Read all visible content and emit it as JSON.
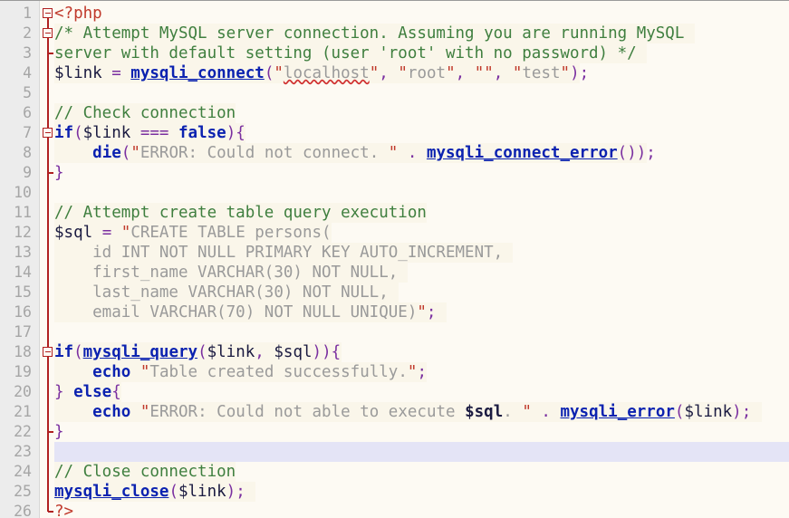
{
  "editor": {
    "language": "PHP",
    "total_lines": 26,
    "current_line": 23,
    "line_height": 22,
    "char_width": 10.55,
    "colors": {
      "background": "#fdfaf3",
      "gutter_background": "#ececec",
      "gutter_text": "#a6a6a6",
      "current_line_highlight": "#e4e4f6",
      "fold_marker": "#b02020",
      "tag": "#c0392b",
      "comment": "#3f7f3f",
      "keyword": "#0b22b0",
      "function": "#0b22b0",
      "variable": "#1a1a40",
      "punctuation": "#7a2fa0",
      "string": "#9a9a9a",
      "quote": "#c0392b",
      "spellcheck_underline": "#d03030"
    }
  },
  "line_numbers": [
    1,
    2,
    3,
    4,
    5,
    6,
    7,
    8,
    9,
    10,
    11,
    12,
    13,
    14,
    15,
    16,
    17,
    18,
    19,
    20,
    21,
    22,
    23,
    24,
    25,
    26
  ],
  "fold_boxes": [
    1,
    2,
    7,
    18
  ],
  "fold_ticks": [
    3,
    9,
    22,
    26
  ],
  "lines": [
    {
      "n": 1,
      "text": "<?php"
    },
    {
      "n": 2,
      "text": "/* Attempt MySQL server connection. Assuming you are running MySQL"
    },
    {
      "n": 3,
      "text": "server with default setting (user 'root' with no password) */"
    },
    {
      "n": 4,
      "text": "$link = mysqli_connect(\"localhost\", \"root\", \"\", \"test\");"
    },
    {
      "n": 5,
      "text": ""
    },
    {
      "n": 6,
      "text": "// Check connection"
    },
    {
      "n": 7,
      "text": "if($link === false){"
    },
    {
      "n": 8,
      "text": "    die(\"ERROR: Could not connect. \" . mysqli_connect_error());"
    },
    {
      "n": 9,
      "text": "}"
    },
    {
      "n": 10,
      "text": ""
    },
    {
      "n": 11,
      "text": "// Attempt create table query execution"
    },
    {
      "n": 12,
      "text": "$sql = \"CREATE TABLE persons("
    },
    {
      "n": 13,
      "text": "    id INT NOT NULL PRIMARY KEY AUTO_INCREMENT,"
    },
    {
      "n": 14,
      "text": "    first_name VARCHAR(30) NOT NULL,"
    },
    {
      "n": 15,
      "text": "    last_name VARCHAR(30) NOT NULL,"
    },
    {
      "n": 16,
      "text": "    email VARCHAR(70) NOT NULL UNIQUE)\";"
    },
    {
      "n": 17,
      "text": ""
    },
    {
      "n": 18,
      "text": "if(mysqli_query($link, $sql)){"
    },
    {
      "n": 19,
      "text": "    echo \"Table created successfully.\";"
    },
    {
      "n": 20,
      "text": "} else{"
    },
    {
      "n": 21,
      "text": "    echo \"ERROR: Could not able to execute $sql. \" . mysqli_error($link);"
    },
    {
      "n": 22,
      "text": "}"
    },
    {
      "n": 23,
      "text": ""
    },
    {
      "n": 24,
      "text": "// Close connection"
    },
    {
      "n": 25,
      "text": "mysqli_close($link);"
    },
    {
      "n": 26,
      "text": "?>"
    }
  ],
  "tokens": {
    "l1": [
      {
        "t": "<?php",
        "c": "t-tag"
      }
    ],
    "l2": [
      {
        "t": "/* Attempt MySQL server connection. Assuming you are running MySQL",
        "c": "t-comment"
      }
    ],
    "l3": [
      {
        "t": "server with default setting (user 'root' with no password) */",
        "c": "t-comment"
      }
    ],
    "l4": [
      {
        "t": "$link ",
        "c": "t-var"
      },
      {
        "t": "= ",
        "c": "t-punc"
      },
      {
        "t": "mysqli_connect",
        "c": "t-fn"
      },
      {
        "t": "(",
        "c": "t-punc"
      },
      {
        "t": "\"",
        "c": "t-quote"
      },
      {
        "t": "localhost",
        "c": "t-str spell"
      },
      {
        "t": "\"",
        "c": "t-quote"
      },
      {
        "t": ", ",
        "c": "t-punc"
      },
      {
        "t": "\"",
        "c": "t-quote"
      },
      {
        "t": "root",
        "c": "t-str"
      },
      {
        "t": "\"",
        "c": "t-quote"
      },
      {
        "t": ", ",
        "c": "t-punc"
      },
      {
        "t": "\"\"",
        "c": "t-quote"
      },
      {
        "t": ", ",
        "c": "t-punc"
      },
      {
        "t": "\"",
        "c": "t-quote"
      },
      {
        "t": "test",
        "c": "t-str"
      },
      {
        "t": "\"",
        "c": "t-quote"
      },
      {
        "t": ");",
        "c": "t-punc"
      }
    ],
    "l6": [
      {
        "t": "// Check connection",
        "c": "t-comment"
      }
    ],
    "l7": [
      {
        "t": "if",
        "c": "t-kw"
      },
      {
        "t": "(",
        "c": "t-punc"
      },
      {
        "t": "$link ",
        "c": "t-var"
      },
      {
        "t": "=== ",
        "c": "t-punc"
      },
      {
        "t": "false",
        "c": "t-kw"
      },
      {
        "t": "){",
        "c": "t-punc"
      }
    ],
    "l8": [
      {
        "t": "    ",
        "c": "t-plain"
      },
      {
        "t": "die",
        "c": "t-kw"
      },
      {
        "t": "(",
        "c": "t-punc"
      },
      {
        "t": "\"",
        "c": "t-quote"
      },
      {
        "t": "ERROR: Could not connect. ",
        "c": "t-str"
      },
      {
        "t": "\"",
        "c": "t-quote"
      },
      {
        "t": " . ",
        "c": "t-punc"
      },
      {
        "t": "mysqli_connect_error",
        "c": "t-fn"
      },
      {
        "t": "());",
        "c": "t-punc"
      }
    ],
    "l9": [
      {
        "t": "}",
        "c": "t-punc"
      }
    ],
    "l11": [
      {
        "t": "// Attempt create table query execution",
        "c": "t-comment"
      }
    ],
    "l12": [
      {
        "t": "$sql ",
        "c": "t-var"
      },
      {
        "t": "= ",
        "c": "t-punc"
      },
      {
        "t": "\"",
        "c": "t-quote"
      },
      {
        "t": "CREATE TABLE persons(",
        "c": "t-str"
      }
    ],
    "l13": [
      {
        "t": "    id INT NOT NULL PRIMARY KEY AUTO_INCREMENT,",
        "c": "t-str"
      }
    ],
    "l14": [
      {
        "t": "    first_name VARCHAR(30) NOT NULL,",
        "c": "t-str"
      }
    ],
    "l15": [
      {
        "t": "    last_name VARCHAR(30) NOT NULL,",
        "c": "t-str"
      }
    ],
    "l16": [
      {
        "t": "    email VARCHAR(70) NOT NULL UNIQUE)",
        "c": "t-str"
      },
      {
        "t": "\"",
        "c": "t-quote"
      },
      {
        "t": ";",
        "c": "t-punc"
      }
    ],
    "l18": [
      {
        "t": "if",
        "c": "t-kw"
      },
      {
        "t": "(",
        "c": "t-punc"
      },
      {
        "t": "mysqli_query",
        "c": "t-fn"
      },
      {
        "t": "(",
        "c": "t-punc"
      },
      {
        "t": "$link",
        "c": "t-var"
      },
      {
        "t": ", ",
        "c": "t-punc"
      },
      {
        "t": "$sql",
        "c": "t-var"
      },
      {
        "t": ")){",
        "c": "t-punc"
      }
    ],
    "l19": [
      {
        "t": "    ",
        "c": "t-plain"
      },
      {
        "t": "echo",
        "c": "t-kw"
      },
      {
        "t": " ",
        "c": "t-plain"
      },
      {
        "t": "\"",
        "c": "t-quote"
      },
      {
        "t": "Table created successfully.",
        "c": "t-str"
      },
      {
        "t": "\"",
        "c": "t-quote"
      },
      {
        "t": ";",
        "c": "t-punc"
      }
    ],
    "l20": [
      {
        "t": "} ",
        "c": "t-punc"
      },
      {
        "t": "else",
        "c": "t-kw"
      },
      {
        "t": "{",
        "c": "t-punc"
      }
    ],
    "l21": [
      {
        "t": "    ",
        "c": "t-plain"
      },
      {
        "t": "echo",
        "c": "t-kw"
      },
      {
        "t": " ",
        "c": "t-plain"
      },
      {
        "t": "\"",
        "c": "t-quote"
      },
      {
        "t": "ERROR: Could not able to execute ",
        "c": "t-str"
      },
      {
        "t": "$sql",
        "c": "t-varb"
      },
      {
        "t": ". ",
        "c": "t-str"
      },
      {
        "t": "\"",
        "c": "t-quote"
      },
      {
        "t": " . ",
        "c": "t-punc"
      },
      {
        "t": "mysqli_error",
        "c": "t-fn"
      },
      {
        "t": "(",
        "c": "t-punc"
      },
      {
        "t": "$link",
        "c": "t-var"
      },
      {
        "t": ");",
        "c": "t-punc"
      }
    ],
    "l22": [
      {
        "t": "}",
        "c": "t-punc"
      }
    ],
    "l24": [
      {
        "t": "// Close connection",
        "c": "t-comment"
      }
    ],
    "l25": [
      {
        "t": "mysqli_close",
        "c": "t-fn"
      },
      {
        "t": "(",
        "c": "t-punc"
      },
      {
        "t": "$link",
        "c": "t-var"
      },
      {
        "t": ");",
        "c": "t-punc"
      }
    ],
    "l26": [
      {
        "t": "?>",
        "c": "t-tag"
      }
    ]
  },
  "tint_runs": [
    {
      "line": 2,
      "start": 0,
      "len": 67
    },
    {
      "line": 3,
      "start": 0,
      "len": 62
    },
    {
      "line": 4,
      "start": 0,
      "len": 55
    },
    {
      "line": 6,
      "start": 0,
      "len": 19
    },
    {
      "line": 7,
      "start": 0,
      "len": 20
    },
    {
      "line": 8,
      "start": 0,
      "len": 62
    },
    {
      "line": 11,
      "start": 0,
      "len": 39
    },
    {
      "line": 12,
      "start": 0,
      "len": 29
    },
    {
      "line": 13,
      "start": 0,
      "len": 48
    },
    {
      "line": 14,
      "start": 0,
      "len": 37
    },
    {
      "line": 15,
      "start": 0,
      "len": 36
    },
    {
      "line": 16,
      "start": 0,
      "len": 41
    },
    {
      "line": 18,
      "start": 0,
      "len": 30
    },
    {
      "line": 19,
      "start": 0,
      "len": 39
    },
    {
      "line": 20,
      "start": 0,
      "len": 7
    },
    {
      "line": 21,
      "start": 0,
      "len": 74
    },
    {
      "line": 24,
      "start": 0,
      "len": 19
    },
    {
      "line": 25,
      "start": 0,
      "len": 21
    }
  ],
  "indent_guides": [
    {
      "col": 4,
      "from_line": 8,
      "to_line": 8
    },
    {
      "col": 4,
      "from_line": 13,
      "to_line": 16
    },
    {
      "col": 4,
      "from_line": 19,
      "to_line": 19
    },
    {
      "col": 4,
      "from_line": 21,
      "to_line": 21
    }
  ]
}
